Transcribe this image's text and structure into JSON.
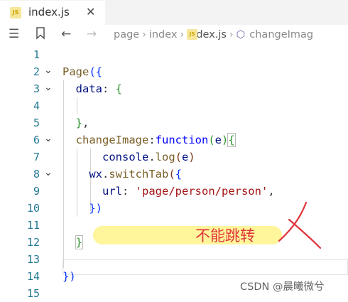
{
  "tab": {
    "badge": "JS",
    "title": "index.js",
    "close": "✕"
  },
  "toolbar": {
    "breadcrumb": [
      "page",
      "index",
      "index.js",
      "changeImag"
    ],
    "js_badge": "JS"
  },
  "code_lines": [
    {
      "n": "1"
    },
    {
      "n": "2"
    },
    {
      "n": "3"
    },
    {
      "n": "4"
    },
    {
      "n": "5"
    },
    {
      "n": "6"
    },
    {
      "n": "7"
    },
    {
      "n": "8"
    },
    {
      "n": "9"
    },
    {
      "n": "10"
    },
    {
      "n": "11"
    },
    {
      "n": "12"
    },
    {
      "n": "13"
    },
    {
      "n": "14"
    },
    {
      "n": "15"
    }
  ],
  "code": {
    "l2_a": "Page",
    "l2_b": "({",
    "l3_a": "data",
    "l3_b": ": ",
    "l3_c": "{",
    "l5_a": "}",
    "l5_b": ",",
    "l6_a": "changeImage",
    "l6_b": ":",
    "l6_c": "function",
    "l6_d": "(",
    "l6_e": "e",
    "l6_f": ")",
    "l6_g": "{",
    "l7_a": "console",
    "l7_b": ".",
    "l7_c": "log",
    "l7_d": "(",
    "l7_e": "e",
    "l7_f": ")",
    "l8_a": "wx",
    "l8_b": ".",
    "l8_c": "switchTab",
    "l8_d": "(",
    "l8_e": "{",
    "l9_a": "url",
    "l9_b": ": ",
    "l9_c": "'page/person/person'",
    "l9_d": ",",
    "l10_a": "})",
    "l12_a": "}",
    "l14_a": "})"
  },
  "annotation": "不能跳转",
  "watermark": "CSDN @晨曦微兮",
  "colors": {
    "keyword": "#0000ff",
    "string": "#a31515",
    "line_number": "#237893",
    "highlight": "#fff59a",
    "annotation": "#e0323a"
  }
}
